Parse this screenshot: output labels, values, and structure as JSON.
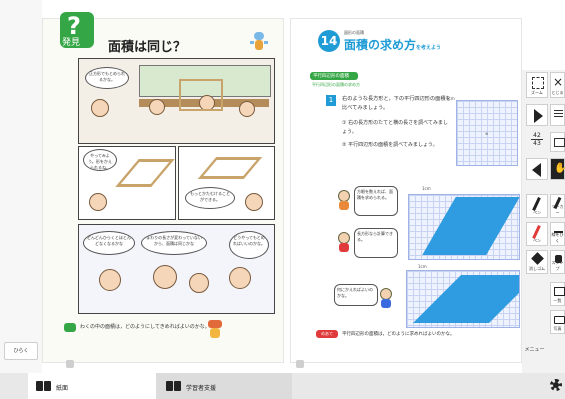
{
  "left_page": {
    "badge_symbol": "?",
    "badge_label": "発見",
    "title": "面積は同じ？",
    "question_badge": "問題",
    "question": "わくの中の面積は，どのようにしてきめればよいのかな。",
    "bubbles": {
      "b1": "正方形でもとめられるかな。",
      "b2": "やってみよう。形をかえられるね。",
      "b3": "もっとかたむけることができる。",
      "b4": "どんどんひらくとほとんどなくなるかな",
      "b5": "まわりの長さが変わっていないから、面積は同じかな",
      "b6": "どうやってもとめればいいのかな。"
    }
  },
  "right_page": {
    "chapter_number": "14",
    "chapter_sub": "図形の面積",
    "title": "面積の求め方",
    "title_suffix": "を考えよう",
    "section_label": "平行四辺形の面積",
    "section_sub": "平行四辺形の面積の求め方",
    "problem_number": "1",
    "prompt": "右のような長方形と，下の平行四辺形の面積を比べてみましょう。",
    "item1": "① 右の長方形のたてと横の長さを調べてみましょう。",
    "item2": "② 平行四辺形の面積を調べてみましょう。",
    "speech1": "方眼を数えれば、面積を求められる。",
    "speech2": "長方形なら計算できる。",
    "speech3": "何にかえればよいのかな。",
    "unit_cm": "1cm",
    "unit_cm2": "1cm",
    "unit_cm3": "1cm",
    "bottom_badge": "めあて",
    "bottom_question": "平行四辺形の面積は，どのように求めればよいのかな。"
  },
  "toolbar": {
    "zoom_label": "ズーム",
    "close_label": "とじる",
    "page_current": "42",
    "page_total": "43",
    "pen_label": "ペン",
    "marker_label": "マーカー",
    "highlighter_label": "線をひく",
    "eraser_label": "消しゴム",
    "stamp_label": "スタンプ",
    "gallery_label": "一覧",
    "camera_label": "写真",
    "menu_label": "メニュー",
    "back_label": "ひらく"
  },
  "bottom_tabs": {
    "front": "紙面",
    "teacher": "学習者支援"
  },
  "colors": {
    "accent_green": "#35a645",
    "accent_blue": "#1f9cd6",
    "shape_blue": "#2f9be0",
    "warn_red": "#e03a3a"
  }
}
